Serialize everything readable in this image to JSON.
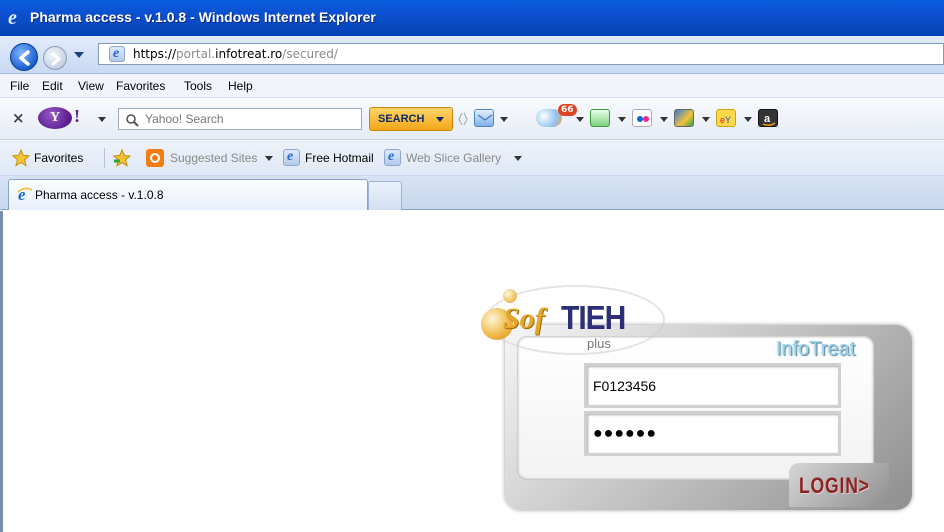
{
  "window": {
    "title": "Pharma access - v.1.0.8 - Windows Internet Explorer"
  },
  "address_bar": {
    "url_scheme": "https://",
    "url_prefix": "portal.",
    "url_host": "infotreat.ro",
    "url_path": "/secured/"
  },
  "menu": {
    "items": [
      "File",
      "Edit",
      "View",
      "Favorites",
      "Tools",
      "Help"
    ]
  },
  "yahoo_toolbar": {
    "logo": "Y!",
    "search_placeholder": "Yahoo! Search",
    "search_button": "SEARCH",
    "mail_badge": "66",
    "icons": [
      "mail-icon",
      "weather-icon",
      "radio-icon",
      "flickr-icon",
      "finance-icon",
      "ebay-icon",
      "amazon-icon"
    ]
  },
  "favorites_bar": {
    "label": "Favorites",
    "links": [
      "Suggested Sites",
      "Free Hotmail",
      "Web Slice Gallery"
    ]
  },
  "tabs": [
    {
      "label": "Pharma access - v.1.0.8",
      "active": true
    }
  ],
  "login": {
    "brand_sof": "Sof",
    "brand_tieh": "TIEH",
    "brand_plus": "plus",
    "product": "InfoTreat",
    "username_value": "F0123456",
    "password_value": "●●●●●●",
    "login_button": "LOGIN>"
  },
  "colors": {
    "titlebar": "#0b4fcf",
    "search_button": "#f3a617",
    "brand_gold": "#e1a82d",
    "brand_navy": "#2a2f78",
    "login_text": "#8a2323"
  }
}
